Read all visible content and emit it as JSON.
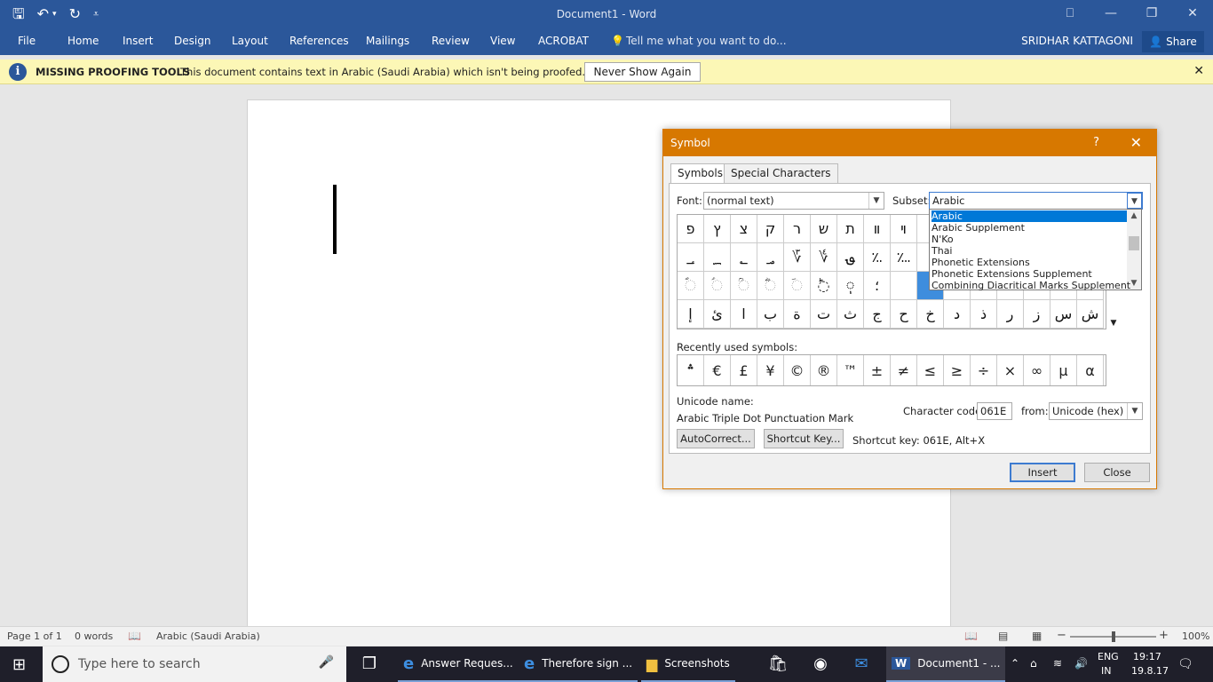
{
  "window": {
    "title": "Document1 - Word",
    "controls": [
      "⎕",
      "—",
      "❐",
      "✕"
    ]
  },
  "qat": {
    "save": "🖫",
    "undo": "↶",
    "undo_arrow": "▾",
    "redo": "↻",
    "customize": "⩡"
  },
  "ribbon": {
    "tabs": [
      "File",
      "Home",
      "Insert",
      "Design",
      "Layout",
      "References",
      "Mailings",
      "Review",
      "View",
      "ACROBAT"
    ],
    "tell_me": "Tell me what you want to do...",
    "user": "SRIDHAR KATTAGONI",
    "share": "Share"
  },
  "message_bar": {
    "title": "MISSING PROOFING TOOLS",
    "text": "This document contains text in Arabic (Saudi Arabia) which isn't being proofed.",
    "button": "Never Show Again",
    "close": "✕"
  },
  "dialog": {
    "title": "Symbol",
    "help": "?",
    "close": "✕",
    "tabs": [
      "Symbols",
      "Special Characters"
    ],
    "font_label": "Font:",
    "font_value": "(normal text)",
    "subset_label": "Subset:",
    "subset_value": "Arabic",
    "subset_options": [
      "Arabic",
      "Arabic Supplement",
      "N'Ko",
      "Thai",
      "Phonetic Extensions",
      "Phonetic Extensions Supplement",
      "Combining Diacritical Marks Supplement"
    ],
    "symbols": [
      [
        "פ",
        "ץ",
        "צ",
        "ק",
        "ר",
        "ש",
        "ת",
        "װ",
        "ױ",
        "",
        "",
        "",
        "",
        "",
        "",
        ""
      ],
      [
        "؀",
        "؁",
        "؂",
        "؃",
        "؆",
        "؇",
        "؈",
        "؉",
        "؊",
        "",
        "",
        "",
        "",
        "",
        "",
        ""
      ],
      [
        "◌ؐ",
        "◌ؑ",
        "◌ؒ",
        "◌ؓ",
        "◌ؔ",
        "◌ؕ",
        "◌ٖ",
        "؛",
        "",
        "",
        "",
        "",
        "",
        "",
        "",
        ""
      ],
      [
        "إ",
        "ئ",
        "ا",
        "ب",
        "ة",
        "ت",
        "ث",
        "ج",
        "ح",
        "خ",
        "د",
        "ذ",
        "ر",
        "ز",
        "س",
        "ش"
      ]
    ],
    "recent_label": "Recently used symbols:",
    "recent": [
      "؞",
      "€",
      "£",
      "¥",
      "©",
      "®",
      "™",
      "±",
      "≠",
      "≤",
      "≥",
      "÷",
      "×",
      "∞",
      "µ",
      "α"
    ],
    "unicode_name_label": "Unicode name:",
    "unicode_name": "Arabic Triple Dot Punctuation Mark",
    "char_code_label": "Character code:",
    "char_code": "061E",
    "from_label": "from:",
    "from_value": "Unicode (hex)",
    "autocorrect": "AutoCorrect...",
    "shortcut_key_btn": "Shortcut Key...",
    "shortcut_key": "Shortcut key: 061E, Alt+X",
    "insert": "Insert",
    "close_btn": "Close"
  },
  "status": {
    "page": "Page 1 of 1",
    "words": "0 words",
    "language": "Arabic (Saudi Arabia)",
    "zoom_minus": "−",
    "zoom_plus": "+",
    "zoom": "100%",
    "zoom_level": 0.5
  },
  "taskbar": {
    "search_placeholder": "Type here to search",
    "apps": [
      "Answer Reques...",
      "Therefore sign ...",
      "Screenshots",
      "Document1 - ..."
    ],
    "lang": "ENG",
    "lang2": "IN",
    "time": "19:17",
    "date": "19.8.17"
  }
}
